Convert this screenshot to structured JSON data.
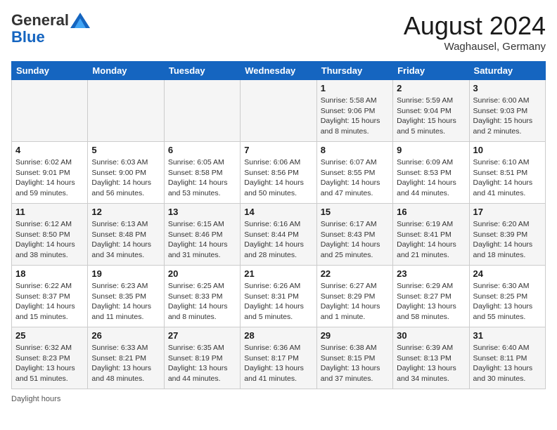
{
  "header": {
    "logo_general": "General",
    "logo_blue": "Blue",
    "month_title": "August 2024",
    "subtitle": "Waghausel, Germany"
  },
  "days_of_week": [
    "Sunday",
    "Monday",
    "Tuesday",
    "Wednesday",
    "Thursday",
    "Friday",
    "Saturday"
  ],
  "weeks": [
    [
      {
        "num": "",
        "info": ""
      },
      {
        "num": "",
        "info": ""
      },
      {
        "num": "",
        "info": ""
      },
      {
        "num": "",
        "info": ""
      },
      {
        "num": "1",
        "info": "Sunrise: 5:58 AM\nSunset: 9:06 PM\nDaylight: 15 hours\nand 8 minutes."
      },
      {
        "num": "2",
        "info": "Sunrise: 5:59 AM\nSunset: 9:04 PM\nDaylight: 15 hours\nand 5 minutes."
      },
      {
        "num": "3",
        "info": "Sunrise: 6:00 AM\nSunset: 9:03 PM\nDaylight: 15 hours\nand 2 minutes."
      }
    ],
    [
      {
        "num": "4",
        "info": "Sunrise: 6:02 AM\nSunset: 9:01 PM\nDaylight: 14 hours\nand 59 minutes."
      },
      {
        "num": "5",
        "info": "Sunrise: 6:03 AM\nSunset: 9:00 PM\nDaylight: 14 hours\nand 56 minutes."
      },
      {
        "num": "6",
        "info": "Sunrise: 6:05 AM\nSunset: 8:58 PM\nDaylight: 14 hours\nand 53 minutes."
      },
      {
        "num": "7",
        "info": "Sunrise: 6:06 AM\nSunset: 8:56 PM\nDaylight: 14 hours\nand 50 minutes."
      },
      {
        "num": "8",
        "info": "Sunrise: 6:07 AM\nSunset: 8:55 PM\nDaylight: 14 hours\nand 47 minutes."
      },
      {
        "num": "9",
        "info": "Sunrise: 6:09 AM\nSunset: 8:53 PM\nDaylight: 14 hours\nand 44 minutes."
      },
      {
        "num": "10",
        "info": "Sunrise: 6:10 AM\nSunset: 8:51 PM\nDaylight: 14 hours\nand 41 minutes."
      }
    ],
    [
      {
        "num": "11",
        "info": "Sunrise: 6:12 AM\nSunset: 8:50 PM\nDaylight: 14 hours\nand 38 minutes."
      },
      {
        "num": "12",
        "info": "Sunrise: 6:13 AM\nSunset: 8:48 PM\nDaylight: 14 hours\nand 34 minutes."
      },
      {
        "num": "13",
        "info": "Sunrise: 6:15 AM\nSunset: 8:46 PM\nDaylight: 14 hours\nand 31 minutes."
      },
      {
        "num": "14",
        "info": "Sunrise: 6:16 AM\nSunset: 8:44 PM\nDaylight: 14 hours\nand 28 minutes."
      },
      {
        "num": "15",
        "info": "Sunrise: 6:17 AM\nSunset: 8:43 PM\nDaylight: 14 hours\nand 25 minutes."
      },
      {
        "num": "16",
        "info": "Sunrise: 6:19 AM\nSunset: 8:41 PM\nDaylight: 14 hours\nand 21 minutes."
      },
      {
        "num": "17",
        "info": "Sunrise: 6:20 AM\nSunset: 8:39 PM\nDaylight: 14 hours\nand 18 minutes."
      }
    ],
    [
      {
        "num": "18",
        "info": "Sunrise: 6:22 AM\nSunset: 8:37 PM\nDaylight: 14 hours\nand 15 minutes."
      },
      {
        "num": "19",
        "info": "Sunrise: 6:23 AM\nSunset: 8:35 PM\nDaylight: 14 hours\nand 11 minutes."
      },
      {
        "num": "20",
        "info": "Sunrise: 6:25 AM\nSunset: 8:33 PM\nDaylight: 14 hours\nand 8 minutes."
      },
      {
        "num": "21",
        "info": "Sunrise: 6:26 AM\nSunset: 8:31 PM\nDaylight: 14 hours\nand 5 minutes."
      },
      {
        "num": "22",
        "info": "Sunrise: 6:27 AM\nSunset: 8:29 PM\nDaylight: 14 hours\nand 1 minute."
      },
      {
        "num": "23",
        "info": "Sunrise: 6:29 AM\nSunset: 8:27 PM\nDaylight: 13 hours\nand 58 minutes."
      },
      {
        "num": "24",
        "info": "Sunrise: 6:30 AM\nSunset: 8:25 PM\nDaylight: 13 hours\nand 55 minutes."
      }
    ],
    [
      {
        "num": "25",
        "info": "Sunrise: 6:32 AM\nSunset: 8:23 PM\nDaylight: 13 hours\nand 51 minutes."
      },
      {
        "num": "26",
        "info": "Sunrise: 6:33 AM\nSunset: 8:21 PM\nDaylight: 13 hours\nand 48 minutes."
      },
      {
        "num": "27",
        "info": "Sunrise: 6:35 AM\nSunset: 8:19 PM\nDaylight: 13 hours\nand 44 minutes."
      },
      {
        "num": "28",
        "info": "Sunrise: 6:36 AM\nSunset: 8:17 PM\nDaylight: 13 hours\nand 41 minutes."
      },
      {
        "num": "29",
        "info": "Sunrise: 6:38 AM\nSunset: 8:15 PM\nDaylight: 13 hours\nand 37 minutes."
      },
      {
        "num": "30",
        "info": "Sunrise: 6:39 AM\nSunset: 8:13 PM\nDaylight: 13 hours\nand 34 minutes."
      },
      {
        "num": "31",
        "info": "Sunrise: 6:40 AM\nSunset: 8:11 PM\nDaylight: 13 hours\nand 30 minutes."
      }
    ]
  ],
  "footer": {
    "daylight_label": "Daylight hours"
  }
}
